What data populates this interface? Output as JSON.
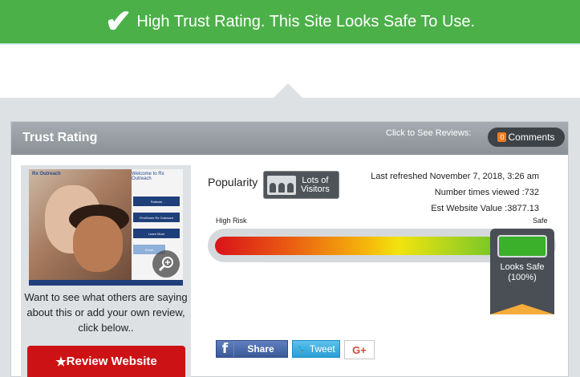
{
  "banner": {
    "icon": "check-icon",
    "check_glyph": "✔",
    "text": "High Trust Rating. This Site Looks Safe To Use.",
    "color": "#4cb049"
  },
  "panel": {
    "title": "Trust Rating",
    "reviews_label": "Click to See Reviews:",
    "comments": {
      "count": "0",
      "label": "Comments"
    }
  },
  "thumbnail": {
    "logo_text": "Rx Outreach",
    "welcome_text": "Welcome to Rx Outreach",
    "menu": [
      "Patients",
      "FindHome Rx Outreach",
      "Learn More",
      "Enroll"
    ]
  },
  "sidebar": {
    "prompt": "Want to see what others are saying about this or add your own review, click below..",
    "review_button": "Review Website",
    "review_star": "★"
  },
  "popularity": {
    "label": "Popularity",
    "badge_line1": "Lots of",
    "badge_line2": "Visitors"
  },
  "stats": {
    "refreshed": "Last refreshed November 7, 2018, 3:26 am",
    "views": "Number times viewed :732",
    "value": "Est Website Value :3877.13"
  },
  "meter": {
    "low_label": "High Risk",
    "high_label": "Safe",
    "marker_line1": "Looks Safe",
    "marker_line2": "(100%)",
    "level": 1.0
  },
  "social": {
    "facebook_glyph": "f",
    "facebook_label": "Share",
    "twitter_glyph": "🐦",
    "twitter_label": "Tweet",
    "gplus_label": "G+"
  }
}
